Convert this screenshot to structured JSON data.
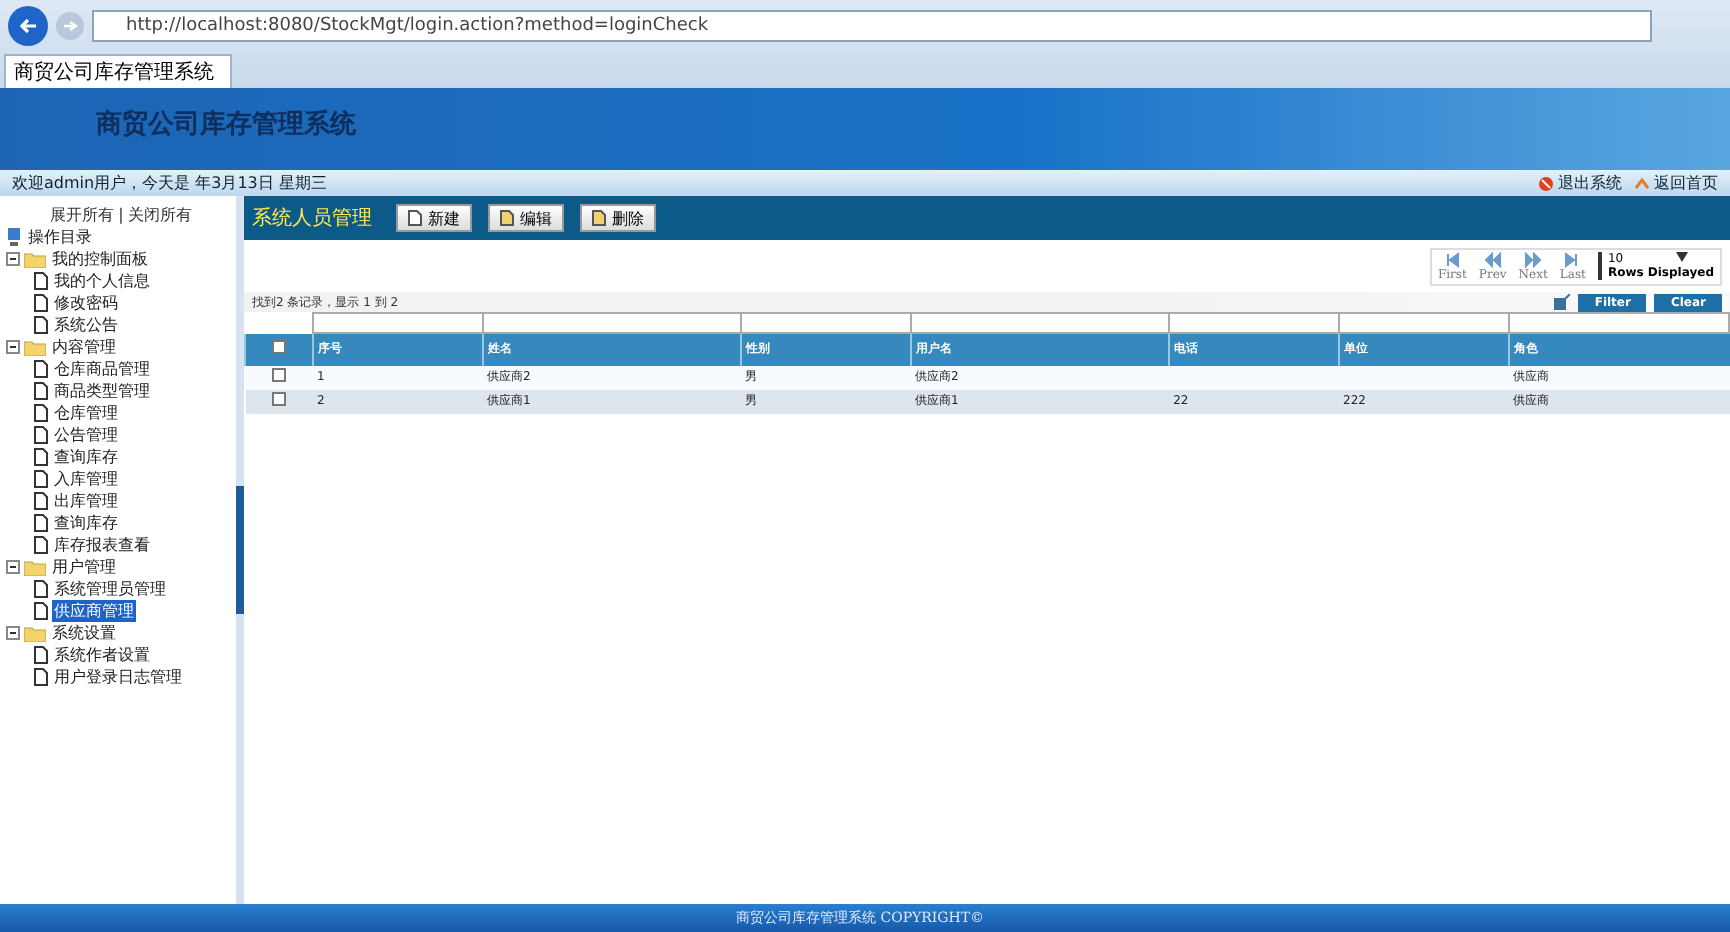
{
  "browser": {
    "address": "http://localhost:8080/StockMgt/login.action?method=loginCheck",
    "tabs": [
      {
        "label": "商贸公司库存管理系统",
        "selected": true
      }
    ]
  },
  "header": {
    "title": "商贸公司库存管理系统"
  },
  "welcome_bar": {
    "greeting": "欢迎admin用户，今天是 年3月13日 星期三",
    "links": [
      {
        "kind": "logout",
        "label": "退出系统"
      },
      {
        "kind": "home",
        "label": "返回首页"
      }
    ]
  },
  "sidebar": {
    "expand_all": "展开所有",
    "separator": "|",
    "collapse_all": "关闭所有",
    "root": "操作目录",
    "tree": [
      {
        "label": "我的控制面板",
        "expanded": true,
        "children": [
          {
            "label": "我的个人信息",
            "selected": false
          },
          {
            "label": "修改密码",
            "selected": false
          },
          {
            "label": "系统公告",
            "selected": false
          }
        ]
      },
      {
        "label": "内容管理",
        "expanded": true,
        "children": [
          {
            "label": "仓库商品管理",
            "selected": false
          },
          {
            "label": "商品类型管理",
            "selected": false
          },
          {
            "label": "仓库管理",
            "selected": false
          },
          {
            "label": "公告管理",
            "selected": false
          },
          {
            "label": "查询库存",
            "selected": false
          },
          {
            "label": "入库管理",
            "selected": false
          },
          {
            "label": "出库管理",
            "selected": false
          },
          {
            "label": "查询库存",
            "selected": false
          },
          {
            "label": "库存报表查看",
            "selected": false
          }
        ]
      },
      {
        "label": "用户管理",
        "expanded": true,
        "children": [
          {
            "label": "系统管理员管理",
            "selected": false
          },
          {
            "label": "供应商管理",
            "selected": true
          }
        ]
      },
      {
        "label": "系统设置",
        "expanded": true,
        "children": [
          {
            "label": "系统作者设置",
            "selected": false
          },
          {
            "label": "用户登录日志管理",
            "selected": false
          }
        ]
      }
    ]
  },
  "toolbar": {
    "title": "系统人员管理",
    "buttons": [
      {
        "kind": "new",
        "label": "新建"
      },
      {
        "kind": "edit",
        "label": "编辑"
      },
      {
        "kind": "delete",
        "label": "删除"
      }
    ]
  },
  "pager": {
    "buttons": [
      {
        "kind": "first",
        "label": "First"
      },
      {
        "kind": "prev",
        "label": "Prev"
      },
      {
        "kind": "next",
        "label": "Next"
      },
      {
        "kind": "last",
        "label": "Last"
      }
    ],
    "rows_value": "10",
    "rows_label": "Rows Displayed"
  },
  "status": "找到2 条记录，显示 1 到 2",
  "filter_buttons": [
    "Filter",
    "Clear"
  ],
  "table": {
    "columns": [
      "序号",
      "姓名",
      "性别",
      "用户名",
      "电话",
      "单位",
      "角色"
    ],
    "header_checked": false,
    "rows": [
      {
        "checked": false,
        "cells": [
          "1",
          "供应商2",
          "男",
          "供应商2",
          "",
          "",
          "供应商"
        ]
      },
      {
        "checked": false,
        "cells": [
          "2",
          "供应商1",
          "男",
          "供应商1",
          "22",
          "222",
          "供应商"
        ]
      }
    ]
  },
  "footer": "商贸公司库存管理系统 COPYRIGHT©"
}
